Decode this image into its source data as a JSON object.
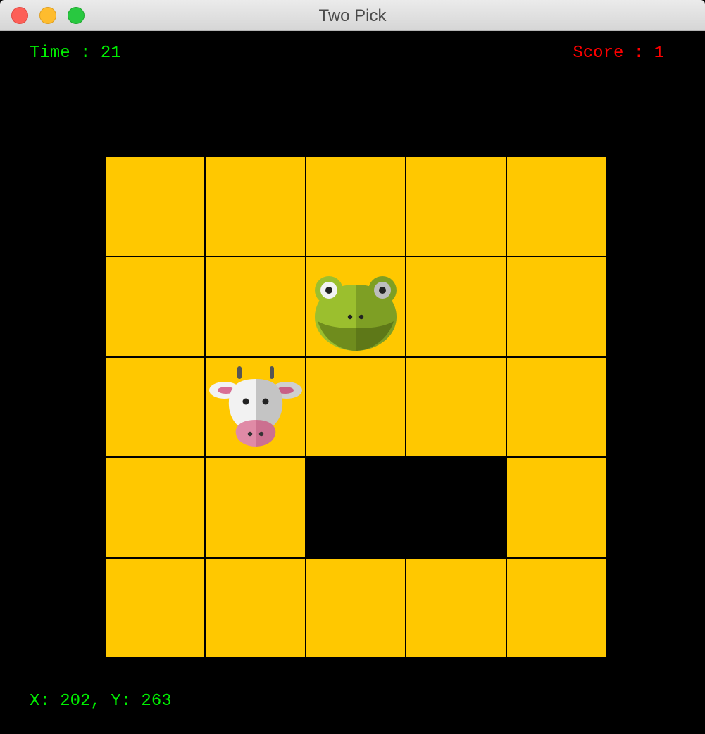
{
  "window": {
    "title": "Two Pick"
  },
  "hud": {
    "time_label": "Time : ",
    "time_value": "21",
    "score_label": "Score : ",
    "score_value": "1",
    "coords_text": "X: 202, Y: 263"
  },
  "colors": {
    "tile": "#ffc800",
    "background": "#000000",
    "hud_green": "#00ee00",
    "hud_red": "#ff0000"
  },
  "board": {
    "rows": 5,
    "cols": 5,
    "tiles": [
      {
        "state": "hidden"
      },
      {
        "state": "hidden"
      },
      {
        "state": "hidden"
      },
      {
        "state": "hidden"
      },
      {
        "state": "hidden"
      },
      {
        "state": "hidden"
      },
      {
        "state": "hidden"
      },
      {
        "state": "revealed",
        "animal": "frog-icon"
      },
      {
        "state": "hidden"
      },
      {
        "state": "hidden"
      },
      {
        "state": "hidden"
      },
      {
        "state": "revealed",
        "animal": "cow-icon"
      },
      {
        "state": "hidden"
      },
      {
        "state": "hidden"
      },
      {
        "state": "hidden"
      },
      {
        "state": "hidden"
      },
      {
        "state": "hidden"
      },
      {
        "state": "removed"
      },
      {
        "state": "removed"
      },
      {
        "state": "hidden"
      },
      {
        "state": "hidden"
      },
      {
        "state": "hidden"
      },
      {
        "state": "hidden"
      },
      {
        "state": "hidden"
      },
      {
        "state": "hidden"
      }
    ]
  }
}
